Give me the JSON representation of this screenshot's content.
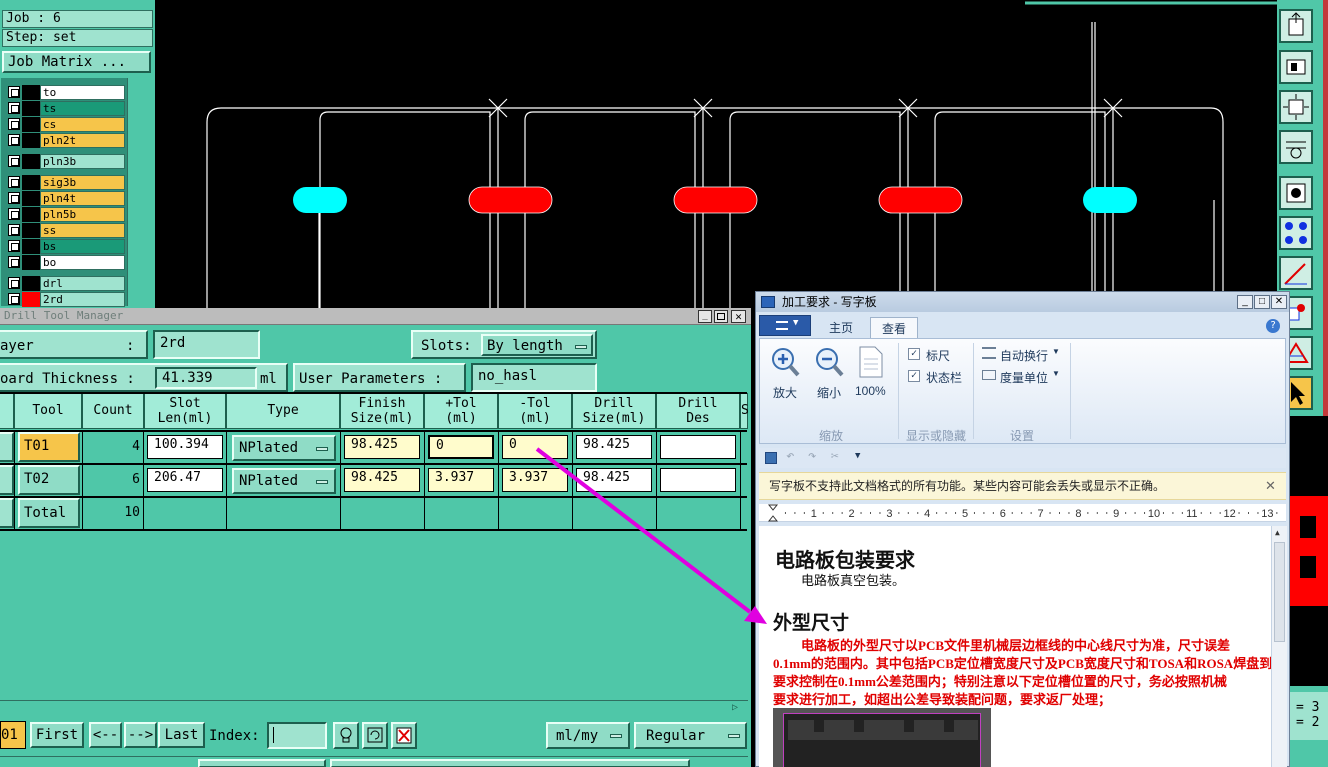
{
  "left_panel": {
    "job": "Job : 6",
    "step": "Step: set",
    "job_matrix_button": "Job Matrix ...",
    "layers": [
      {
        "name": "to",
        "color": "#ffffff"
      },
      {
        "name": "ts",
        "color": "#1a9a78"
      },
      {
        "name": "cs",
        "color": "#f6c54a"
      },
      {
        "name": "pln2t",
        "color": "#f6c54a"
      },
      {
        "name": "pln3b",
        "color": "#9fe3cf"
      },
      {
        "name": "sig3b",
        "color": "#f6c54a"
      },
      {
        "name": "pln4t",
        "color": "#f6c54a"
      },
      {
        "name": "pln5b",
        "color": "#f6c54a"
      },
      {
        "name": "ss",
        "color": "#f6c54a"
      },
      {
        "name": "bs",
        "color": "#1a9a78"
      },
      {
        "name": "bo",
        "color": "#ffffff"
      },
      {
        "name": "drl",
        "color": "#9fe3cf"
      },
      {
        "name": "2rd",
        "color": "#9fe3cf"
      }
    ]
  },
  "drill_tool_manager": {
    "title": "Drill Tool Manager",
    "layer_label": "ayer",
    "layer_colon": ":",
    "layer_value": "2rd",
    "slots_label": "Slots:",
    "slots_value": "By length",
    "board_thickness_label": "oard Thickness :",
    "board_thickness_value": "41.339",
    "board_thickness_unit": "ml",
    "user_params_label": "User Parameters :",
    "user_params_value": "no_hasl",
    "columns": [
      "Tool",
      "Count",
      "Slot\nLen(ml)",
      "Type",
      "Finish\nSize(ml)",
      "+Tol\n(ml)",
      "-Tol\n(ml)",
      "Drill\nSize(ml)",
      "Drill\nDes",
      "S"
    ],
    "rows": [
      {
        "tool": "T01",
        "count": "4",
        "slot_len": "100.394",
        "type": "NPlated",
        "finish": "98.425",
        "ptol": "0",
        "mtol": "0",
        "drill": "98.425",
        "des": ""
      },
      {
        "tool": "T02",
        "count": "6",
        "slot_len": "206.47",
        "type": "NPlated",
        "finish": "98.425",
        "ptol": "3.937",
        "mtol": "3.937",
        "drill": "98.425",
        "des": ""
      }
    ],
    "total_label": "Total",
    "total_count": "10",
    "nav": {
      "left_value": "01",
      "first": "First",
      "prev": "<--",
      "next": "-->",
      "last": "Last",
      "index_label": "Index:",
      "units": "ml/my",
      "mode": "Regular"
    }
  },
  "wordpad": {
    "title": "加工要求 - 写字板",
    "tabs": [
      "主页",
      "查看"
    ],
    "active_tab": "查看",
    "zoom_group": {
      "zoom_in": "放大",
      "zoom_out": "缩小",
      "percent": "100%",
      "group_label": "缩放"
    },
    "show_group": {
      "ruler": "标尺",
      "statusbar": "状态栏",
      "group_label": "显示或隐藏"
    },
    "settings_group": {
      "wrap": "自动换行",
      "units": "度量单位",
      "group_label": "设置"
    },
    "info_bar": "写字板不支持此文档格式的所有功能。某些内容可能会丢失或显示不正确。",
    "ruler_numbers": [
      "1",
      "2",
      "3",
      "4",
      "5",
      "6",
      "7",
      "8",
      "9",
      "10",
      "11",
      "12",
      "13"
    ],
    "doc": {
      "h1": "电路板包装要求",
      "p1": "电路板真空包装。",
      "h2": "外型尺寸",
      "red_lines": [
        "电路板的外型尺寸以PCB文件里机械层边框线的中心线尺寸为准，尺寸误差",
        "0.1mm的范围内。其中包括PCB定位槽宽度尺寸及PCB宽度尺寸和TOSA和ROSA焊盘到",
        "要求控制在0.1mm公差范围内；特别注意以下定位槽位置的尺寸，务必按照机械",
        "要求进行加工，如超出公差导致装配问题，要求返厂处理；"
      ]
    }
  },
  "right_status": {
    "line1": "= 3",
    "line2": "= 2"
  },
  "colors": {
    "panel": "#4fc7a8",
    "slot_cyan": "#00ffff",
    "slot_red": "#ff0000",
    "arrow": "#e000e0",
    "doc_red": "#e00000"
  }
}
